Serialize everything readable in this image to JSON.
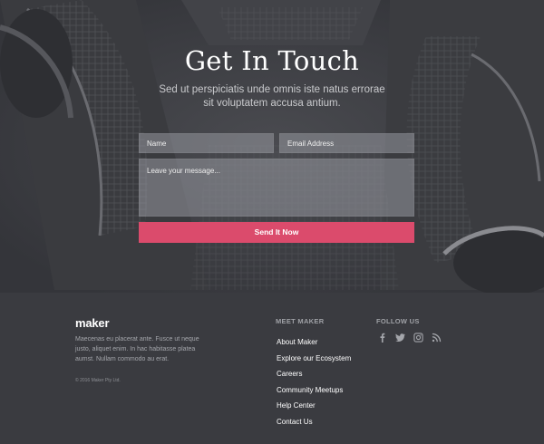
{
  "hero": {
    "title": "Get In Touch",
    "subtitle": "Sed ut perspiciatis unde omnis iste natus errorae sit voluptatem accusa antium.",
    "form": {
      "name_placeholder": "Name",
      "email_placeholder": "Email Address",
      "message_placeholder": "Leave your message...",
      "submit_label": "Send It Now"
    }
  },
  "footer": {
    "logo": "maker",
    "about": "Maecenas eu placerat ante. Fusce ut neque justo,  aliquet enim. In hac habitasse platea aumst. Nullam commodo au erat.",
    "copyright": "© 2016 Maker Pty Ltd.",
    "meet_heading": "MEET MAKER",
    "follow_heading": "FOLLOW US",
    "links": [
      {
        "label": "About Maker"
      },
      {
        "label": "Explore our Ecosystem"
      },
      {
        "label": "Careers"
      },
      {
        "label": "Community Meetups"
      },
      {
        "label": "Help Center"
      },
      {
        "label": "Contact Us"
      }
    ],
    "social": [
      {
        "icon": "facebook-icon"
      },
      {
        "icon": "twitter-icon"
      },
      {
        "icon": "instagram-icon"
      },
      {
        "icon": "rss-icon"
      }
    ]
  },
  "colors": {
    "accent": "#db4b6c",
    "hero_bg": "#3d3e42",
    "footer_bg": "#3a3b40"
  }
}
